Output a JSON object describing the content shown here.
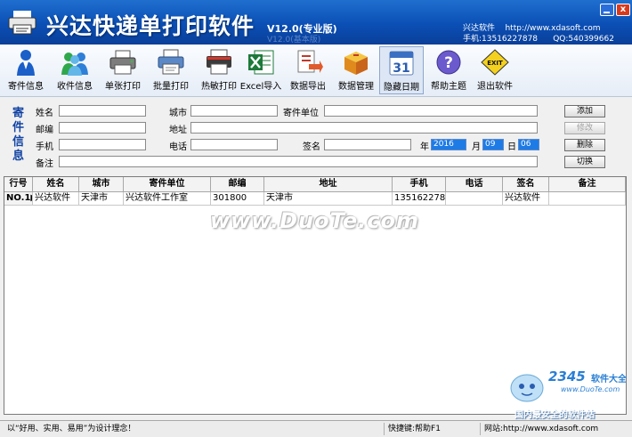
{
  "titlebar": {
    "title": "兴达快递单打印软件",
    "version": "V12.0(专业版)",
    "version_ghost": "V12.0(基本版)",
    "company_name": "兴达软件",
    "company_url": "http://www.xdasoft.com",
    "phone": "手机:13516227878",
    "qq": "QQ:540399662"
  },
  "toolbar": {
    "items": [
      {
        "label": "寄件信息",
        "icon": "sender-person-icon"
      },
      {
        "label": "收件信息",
        "icon": "recipients-group-icon"
      },
      {
        "label": "单张打印",
        "icon": "printer-icon"
      },
      {
        "label": "批量打印",
        "icon": "batch-printer-icon"
      },
      {
        "label": "热敏打印",
        "icon": "thermal-printer-icon"
      },
      {
        "label": "Excel导入",
        "icon": "excel-icon"
      },
      {
        "label": "数据导出",
        "icon": "export-icon"
      },
      {
        "label": "数据管理",
        "icon": "box-icon"
      },
      {
        "label": "隐藏日期",
        "icon": "calendar-icon",
        "calendar_day": "31"
      },
      {
        "label": "帮助主题",
        "icon": "help-icon"
      },
      {
        "label": "退出软件",
        "icon": "exit-sign-icon",
        "sign_text": "EXIT"
      }
    ]
  },
  "sender_form": {
    "section_label": "寄件信息",
    "labels": {
      "name": "姓名",
      "postcode": "邮编",
      "mobile": "手机",
      "remark": "备注",
      "city": "城市",
      "address": "地址",
      "phone": "电话",
      "company": "寄件单位",
      "signature": "签名",
      "year": "年",
      "month": "月",
      "day": "日"
    },
    "values": {
      "name": "",
      "postcode": "",
      "mobile": "",
      "remark": "",
      "city": "",
      "address": "",
      "phone": "",
      "company": "",
      "signature": "",
      "year": "2016",
      "month": "09",
      "day": "06"
    },
    "buttons": {
      "add": "添加",
      "modify": "修改",
      "delete": "删除",
      "switch": "切换"
    }
  },
  "table": {
    "columns": [
      "行号",
      "姓名",
      "城市",
      "寄件单位",
      "邮编",
      "地址",
      "手机",
      "电话",
      "签名",
      "备注"
    ],
    "rows": [
      {
        "row_no": "NO.1",
        "name": "兴达软件",
        "city": "天津市",
        "company": "兴达软件工作室",
        "postcode": "301800",
        "address": "天津市",
        "mobile": "13516227878",
        "phone": "",
        "signature": "兴达软件",
        "remark": ""
      }
    ]
  },
  "overlays": {
    "watermark": "www.DuoTe.com",
    "badge_number": "2345",
    "badge_name": "软件大全",
    "badge_url": "www.DuoTe.com",
    "slogan": "国内最安全的软件站"
  },
  "statusbar": {
    "motto": "以“好用、实用、易用”为设计理念！",
    "shortcut": "快捷键:帮助F1",
    "website": "网站:http://www.xdasoft.com"
  },
  "colors": {
    "titlebar": "#0b4fb5",
    "label_blue": "#1244a3",
    "date_field": "#1e7be6"
  }
}
